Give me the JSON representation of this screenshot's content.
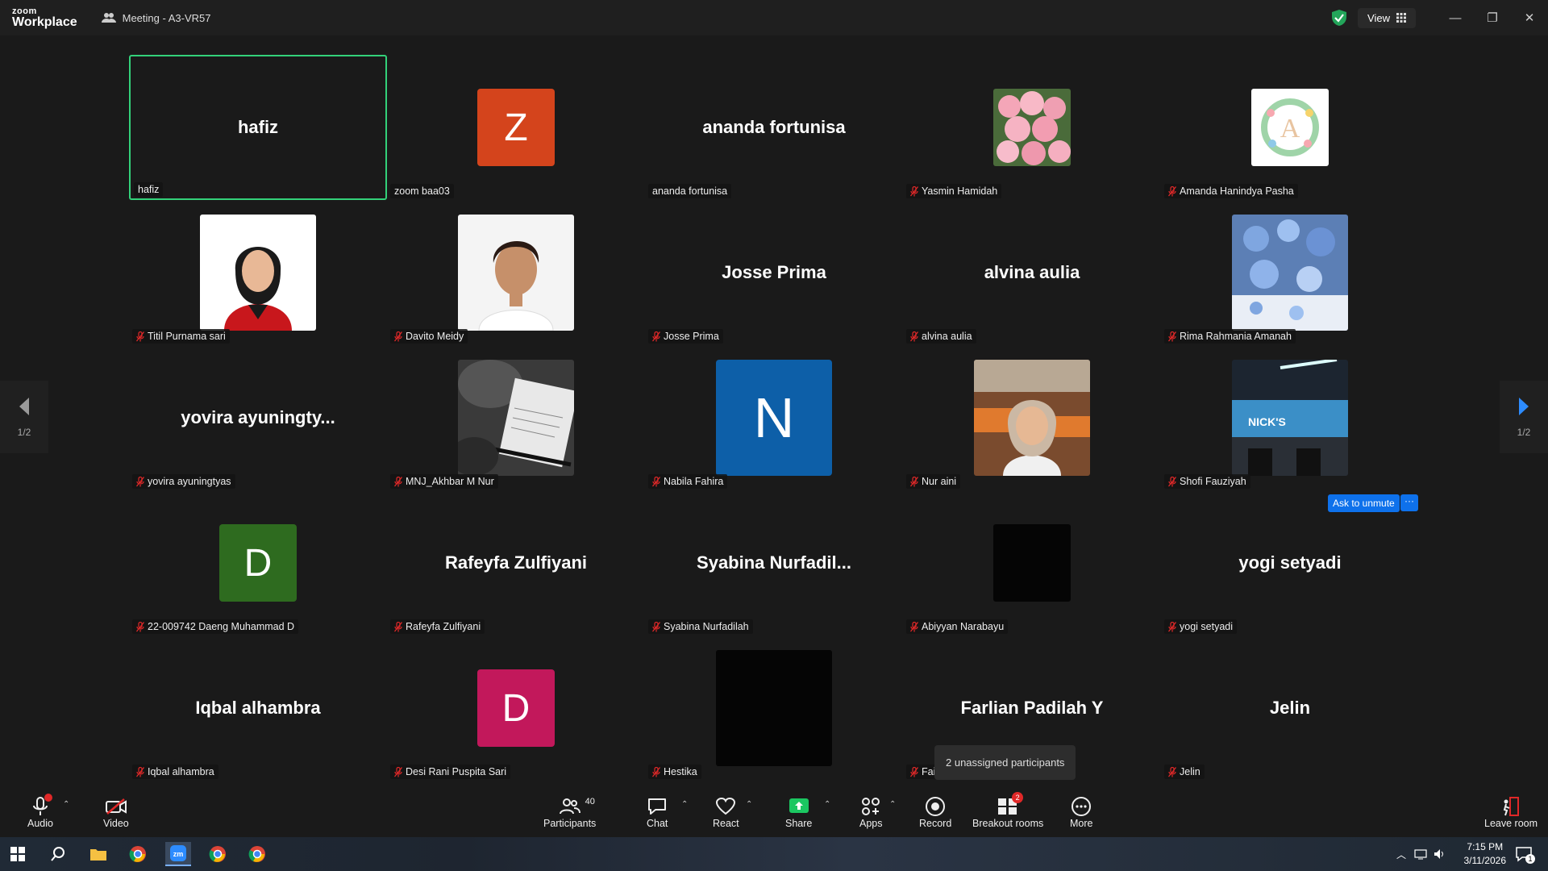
{
  "window": {
    "logo_top": "zoom",
    "logo_bottom": "Workplace",
    "meeting_title": "Meeting - A3-VR57",
    "view_label": "View"
  },
  "pager": {
    "page": "1/2"
  },
  "tiles": [
    {
      "label": "hafiz",
      "big": "hafiz",
      "muted": false,
      "active": true
    },
    {
      "label": "zoom baa03",
      "avatar_letter": "Z",
      "avatar_color": "#d4441c",
      "muted": false
    },
    {
      "label": "ananda fortunisa",
      "big": "ananda fortunisa",
      "muted": false
    },
    {
      "label": "Yasmin Hamidah",
      "muted": true,
      "photo": "roses"
    },
    {
      "label": "Amanda Hanindya Pasha",
      "muted": true,
      "photo": "wreath-a"
    },
    {
      "label": "Titil Purnama sari",
      "muted": true,
      "photo": "woman-red"
    },
    {
      "label": "Davito Meidy",
      "muted": true,
      "photo": "man-white"
    },
    {
      "label": "Josse Prima",
      "big": "Josse Prima",
      "muted": true
    },
    {
      "label": "alvina aulia",
      "big": "alvina aulia",
      "muted": true
    },
    {
      "label": "Rima Rahmania Amanah",
      "muted": true,
      "photo": "blue-flowers"
    },
    {
      "label": "yovira ayuningtyas",
      "big": "yovira  ayuningty...",
      "muted": true
    },
    {
      "label": "MNJ_Akhbar M Nur",
      "muted": true,
      "photo": "notebook"
    },
    {
      "label": "Nabila Fahira",
      "avatar_letter": "N",
      "avatar_color": "#0d5fa8",
      "muted": true,
      "large_avatar": true
    },
    {
      "label": "Nur aini",
      "muted": true,
      "photo": "selfie"
    },
    {
      "label": "Shofi Fauziyah",
      "muted": true,
      "photo": "store"
    },
    {
      "label": "22-009742 Daeng Muhammad D",
      "avatar_letter": "D",
      "avatar_color": "#2e6b1f",
      "muted": true
    },
    {
      "label": "Rafeyfa Zulfiyani",
      "big": "Rafeyfa Zulfiyani",
      "muted": true
    },
    {
      "label": "Syabina Nurfadilah",
      "big": "Syabina  Nurfadil...",
      "muted": true
    },
    {
      "label": "Abiyyan Narabayu",
      "muted": true,
      "photo": "black"
    },
    {
      "label": "yogi setyadi",
      "big": "yogi setyadi",
      "muted": true
    },
    {
      "label": "Iqbal alhambra",
      "big": "Iqbal alhambra",
      "muted": true
    },
    {
      "label": "Desi Rani Puspita Sari",
      "avatar_letter": "D",
      "avatar_color": "#c2185b",
      "muted": true
    },
    {
      "label": "Hestika",
      "muted": true,
      "photo": "black-large"
    },
    {
      "label": "Fai",
      "big": "Farlian Padilah Y",
      "muted": true
    },
    {
      "label": "Jelin",
      "big": "Jelin",
      "muted": true
    }
  ],
  "ask_unmute": "Ask to unmute",
  "ask_more": "···",
  "tooltip": "2 unassigned participants",
  "toolbar": {
    "audio": "Audio",
    "video": "Video",
    "participants": "Participants",
    "participants_count": "40",
    "chat": "Chat",
    "react": "React",
    "share": "Share",
    "apps": "Apps",
    "record": "Record",
    "breakout": "Breakout rooms",
    "breakout_badge": "2",
    "more": "More",
    "leave": "Leave room"
  },
  "taskbar": {
    "time": "7:15 PM",
    "date": "3/11/2026",
    "notif_count": "1"
  },
  "colors": {
    "accent_blue": "#0e71eb",
    "active_border": "#33d17a",
    "share_green": "#1bc761",
    "mute_red": "#e02828"
  }
}
